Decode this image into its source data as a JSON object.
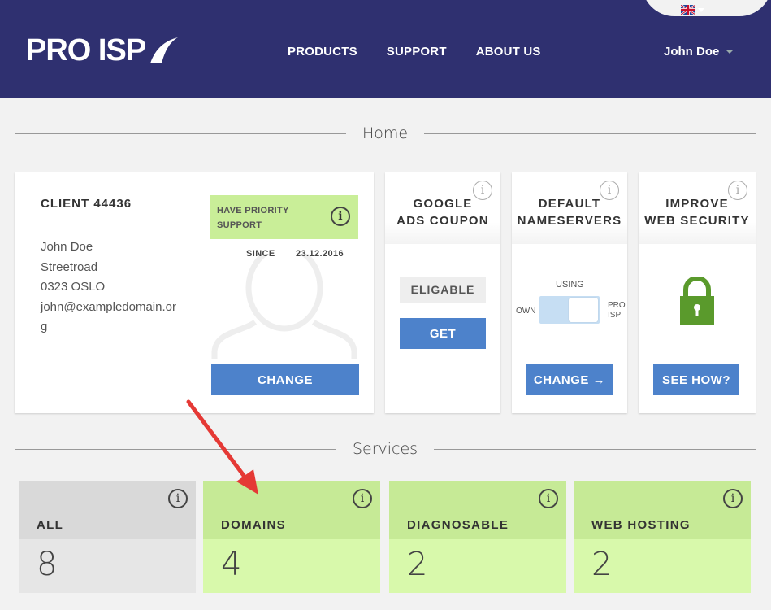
{
  "brand": {
    "logo_text": "PRO ISP"
  },
  "nav": {
    "items": [
      "PRODUCTS",
      "SUPPORT",
      "ABOUT US"
    ]
  },
  "user": {
    "name": "John Doe"
  },
  "sections": {
    "home": "Home",
    "services": "Services"
  },
  "client": {
    "title": "CLIENT 44436",
    "address": [
      "John Doe",
      "Streetroad",
      "0323 OSLO",
      "john@exampledomain.or",
      "g"
    ],
    "priority_label": "HAVE PRIORITY SUPPORT",
    "since_label": "SINCE",
    "since_date": "23.12.2016",
    "change_label": "CHANGE"
  },
  "google": {
    "title_line1": "GOOGLE",
    "title_line2": "ADS COUPON",
    "status": "ELIGABLE",
    "get_label": "GET"
  },
  "nameservers": {
    "title_line1": "DEFAULT",
    "title_line2": "NAMESERVERS",
    "using_label": "USING",
    "own_label": "OWN",
    "pro_label_1": "PRO",
    "pro_label_2": "ISP",
    "change_label": "CHANGE →"
  },
  "security": {
    "title_line1": "IMPROVE",
    "title_line2": "WEB SECURITY",
    "button_label": "SEE HOW?"
  },
  "services": [
    {
      "name": "ALL",
      "count": "8"
    },
    {
      "name": "DOMAINS",
      "count": "4"
    },
    {
      "name": "DIAGNOSABLE",
      "count": "2"
    },
    {
      "name": "WEB HOSTING",
      "count": "2"
    }
  ],
  "info_glyph": "i",
  "colors": {
    "header_bg": "#2f3070",
    "button": "#4d82cb",
    "green_tile": "#d8f9ab",
    "lock": "#5a9a2c",
    "annotation": "#e53935"
  }
}
